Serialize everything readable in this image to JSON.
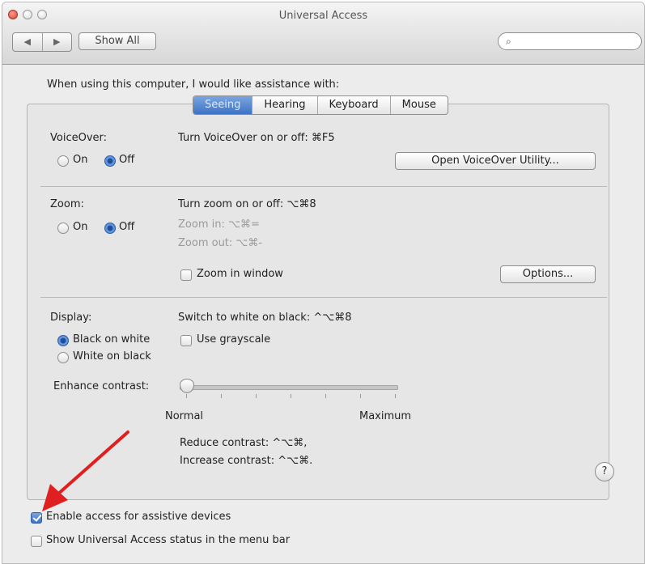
{
  "window": {
    "title": "Universal Access"
  },
  "toolbar": {
    "back_glyph": "◀",
    "forward_glyph": "▶",
    "show_all_label": "Show All",
    "search_placeholder": "",
    "search_glyph": "⌕"
  },
  "intro_text": "When using this computer, I would like assistance with:",
  "tabs": [
    {
      "label": "Seeing",
      "active": true
    },
    {
      "label": "Hearing",
      "active": false
    },
    {
      "label": "Keyboard",
      "active": false
    },
    {
      "label": "Mouse",
      "active": false
    }
  ],
  "voiceover": {
    "label": "VoiceOver:",
    "on_label": "On",
    "off_label": "Off",
    "selected": "Off",
    "shortcut_text": "Turn VoiceOver on or off: ⌘F5",
    "utility_button": "Open VoiceOver Utility..."
  },
  "zoom": {
    "label": "Zoom:",
    "on_label": "On",
    "off_label": "Off",
    "selected": "Off",
    "shortcut_text": "Turn zoom on or off: ⌥⌘8",
    "zoom_in_text": "Zoom in: ⌥⌘=",
    "zoom_out_text": "Zoom out: ⌥⌘-",
    "zoom_in_window_label": "Zoom in window",
    "zoom_in_window_checked": false,
    "options_button": "Options..."
  },
  "display": {
    "label": "Display:",
    "black_on_white_label": "Black on white",
    "white_on_black_label": "White on black",
    "selected": "Black on white",
    "switch_text": "Switch to white on black: ^⌥⌘8",
    "grayscale_label": "Use grayscale",
    "grayscale_checked": false,
    "enhance_contrast_label": "Enhance contrast:",
    "contrast_min_label": "Normal",
    "contrast_max_label": "Maximum",
    "contrast_value": 0,
    "reduce_contrast_text": "Reduce contrast: ^⌥⌘,",
    "increase_contrast_text": "Increase contrast: ^⌥⌘."
  },
  "help_glyph": "?",
  "footer": {
    "assistive_label": "Enable access for assistive devices",
    "assistive_checked": true,
    "status_label": "Show Universal Access status in the menu bar",
    "status_checked": false
  },
  "colors": {
    "selected_tab": "#3d72c5",
    "annotation_arrow": "#e02020"
  }
}
